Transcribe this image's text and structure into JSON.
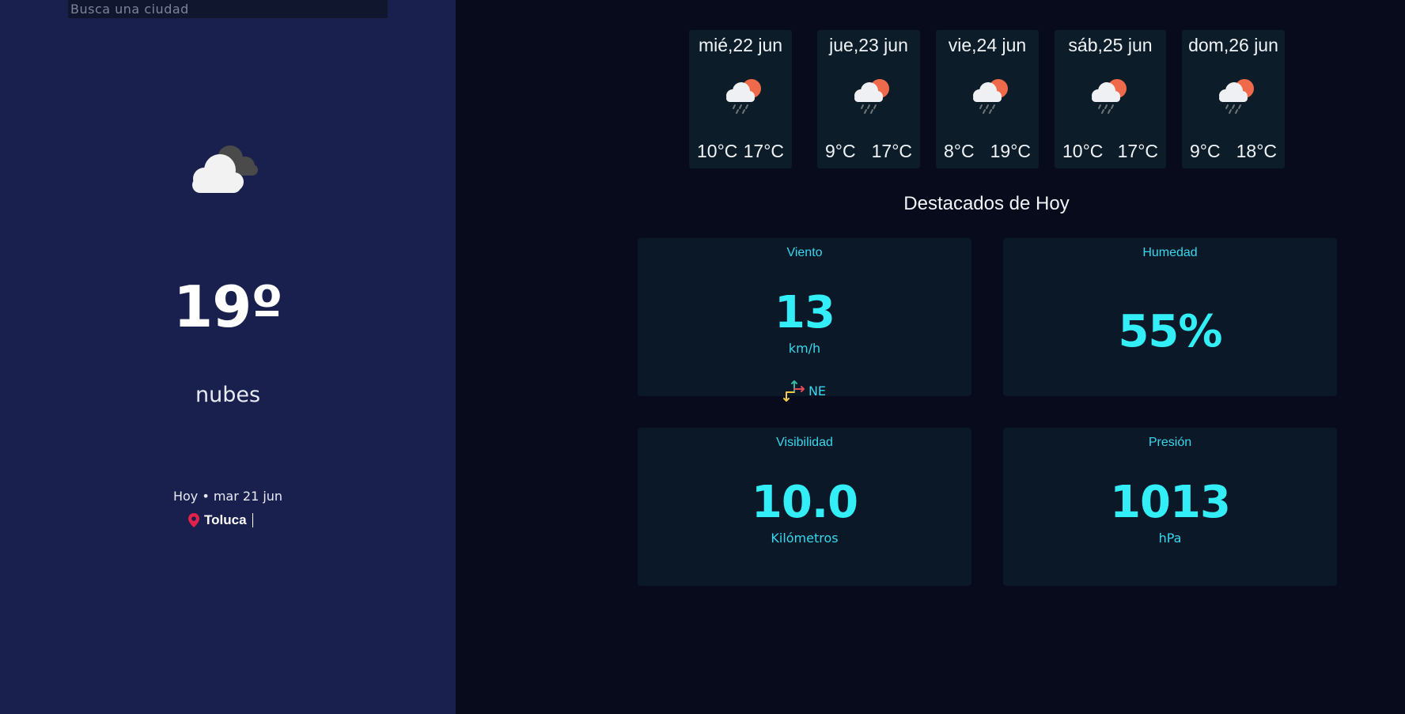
{
  "search": {
    "placeholder": "Busca una ciudad",
    "value": ""
  },
  "current": {
    "icon": "clouds-icon",
    "temperature": "19º",
    "description": "nubes",
    "date": "Hoy • mar 21 jun",
    "location": "Toluca"
  },
  "forecast": [
    {
      "day": "mié,22 jun",
      "icon": "sun-cloud-rain-icon",
      "min": "10°C",
      "max": "17°C"
    },
    {
      "day": "jue,23 jun",
      "icon": "sun-cloud-rain-icon",
      "min": "9°C",
      "max": "17°C"
    },
    {
      "day": "vie,24 jun",
      "icon": "sun-cloud-rain-icon",
      "min": "8°C",
      "max": "19°C"
    },
    {
      "day": "sáb,25 jun",
      "icon": "sun-cloud-rain-icon",
      "min": "10°C",
      "max": "17°C"
    },
    {
      "day": "dom,26 jun",
      "icon": "sun-cloud-rain-icon",
      "min": "9°C",
      "max": "18°C"
    }
  ],
  "highlights": {
    "heading": "Destacados de Hoy",
    "wind": {
      "title": "Viento",
      "value": "13",
      "unit": "km/h",
      "direction": "NE",
      "icon": "wind-direction-icon"
    },
    "humidity": {
      "title": "Humedad",
      "value": "55%"
    },
    "visibility": {
      "title": "Visibilidad",
      "value": "10.0",
      "unit": "Kilómetros"
    },
    "pressure": {
      "title": "Presión",
      "value": "1013",
      "unit": "hPa"
    }
  },
  "colors": {
    "sidebar_bg": "#19204d",
    "page_bg": "#070b1c",
    "accent": "#33eef6",
    "pin": "#e2224b",
    "sun": "#ef6a4a"
  }
}
